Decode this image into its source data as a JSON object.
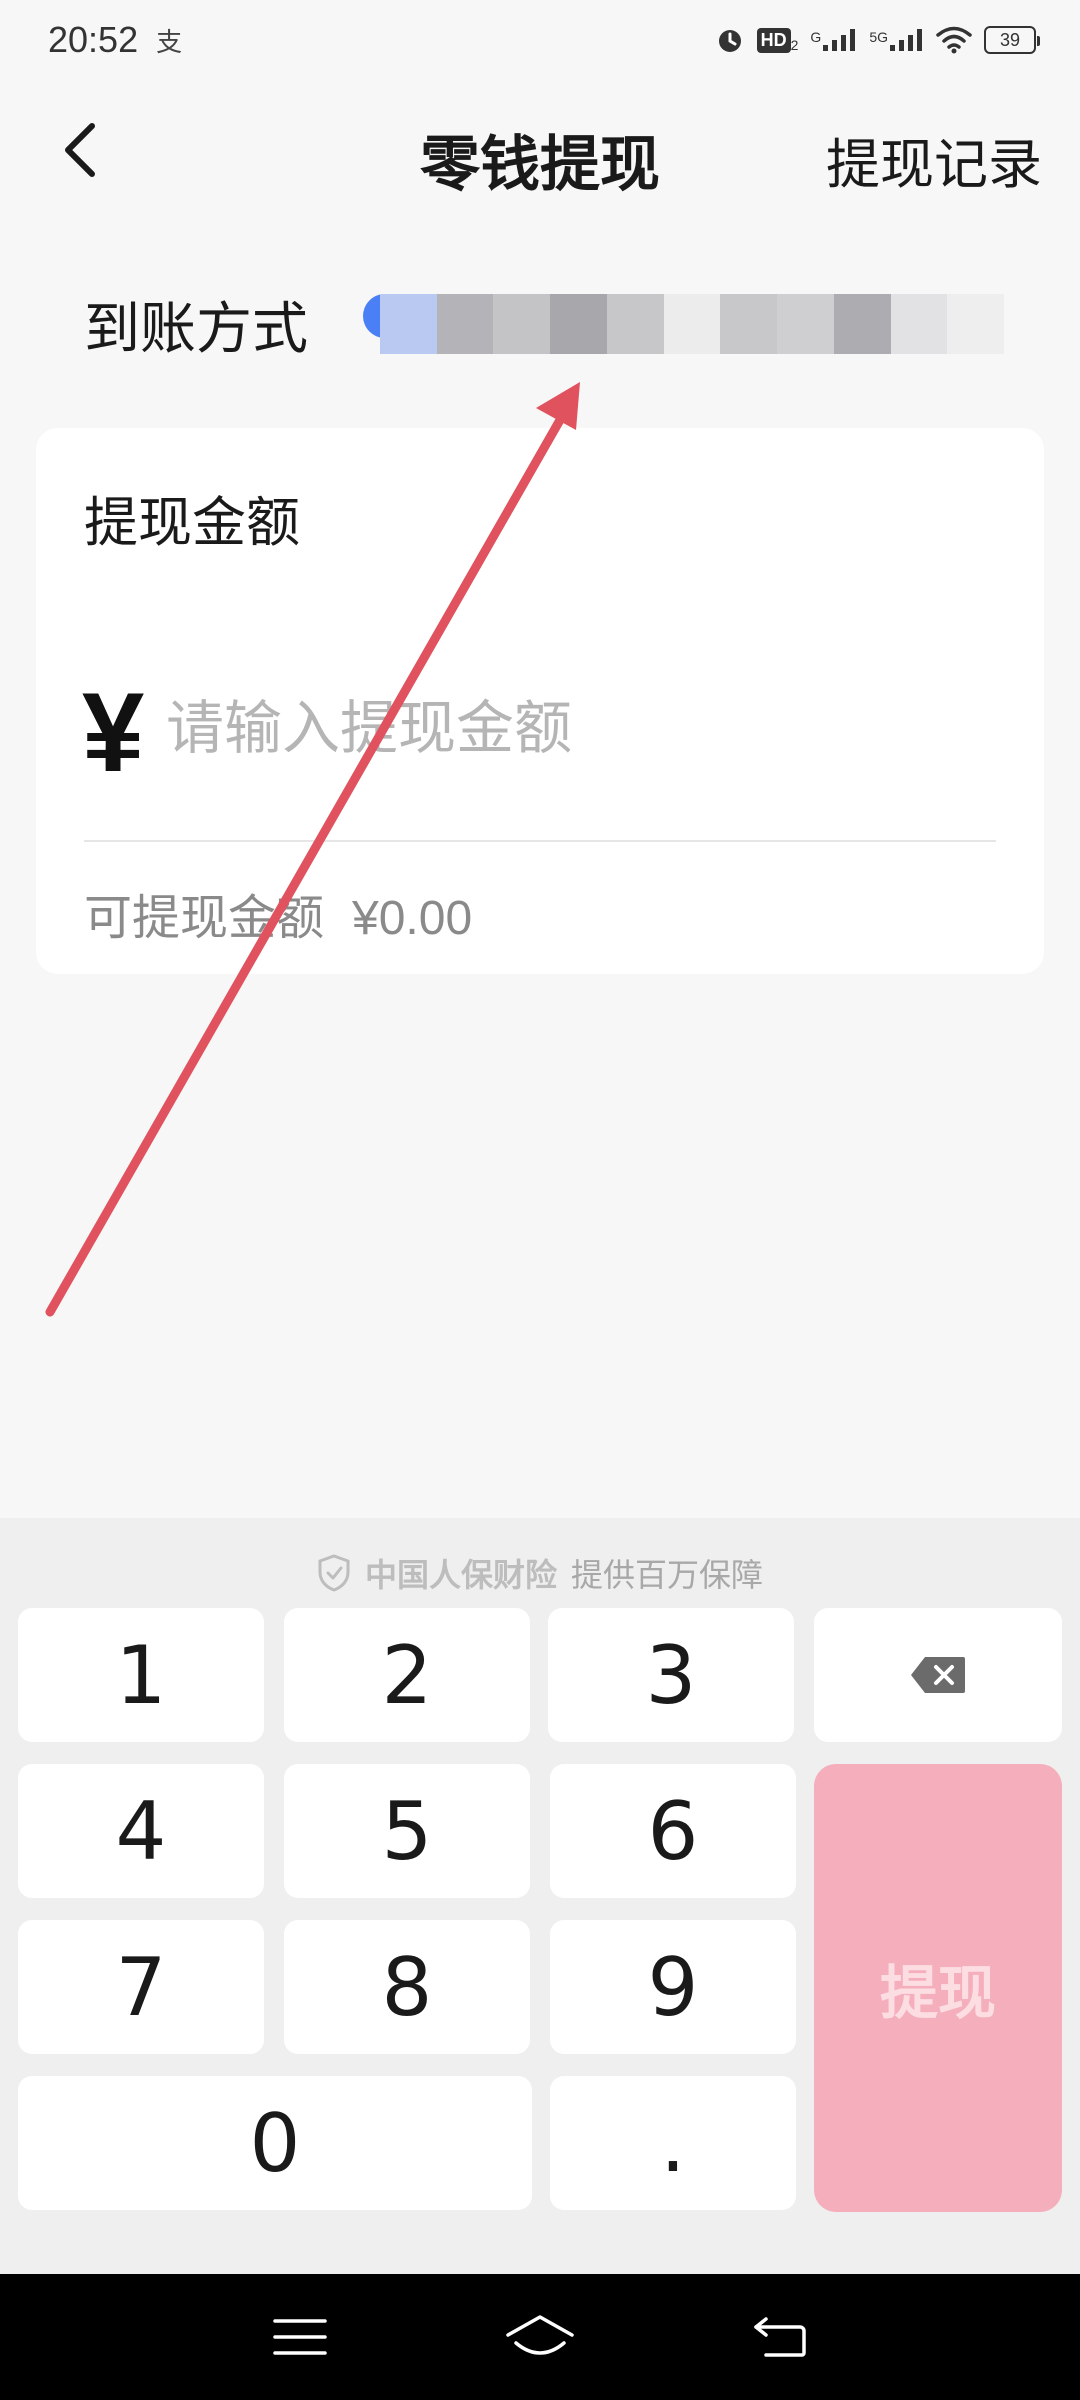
{
  "status_bar": {
    "time": "20:52",
    "app_indicator": "支",
    "hd_label": "HD",
    "hd_sub": "2",
    "signal1_label": "G",
    "signal2_label": "5G",
    "battery_level": "39"
  },
  "nav": {
    "title": "零钱提现",
    "history_link": "提现记录"
  },
  "method": {
    "label": "到账方式",
    "account_blurred": true,
    "icon_color": "#4a7ff5"
  },
  "card": {
    "title": "提现金额",
    "currency": "¥",
    "input_placeholder": "请输入提现金额",
    "input_value": "",
    "available_label": "可提现金额",
    "available_value": "¥0.00"
  },
  "keyboard": {
    "insurance_brand": "中国人保财险",
    "insurance_text": "提供百万保障",
    "keys": {
      "k1": "1",
      "k2": "2",
      "k3": "3",
      "k4": "4",
      "k5": "5",
      "k6": "6",
      "k7": "7",
      "k8": "8",
      "k9": "9",
      "k0": "0",
      "kdot": "."
    },
    "backspace_icon": "backspace-icon",
    "submit_label": "提现",
    "submit_color": "#f5aebb"
  },
  "annotation": {
    "arrow_color": "#e0525e"
  },
  "system_nav": {
    "menu_icon": "menu-icon",
    "home_icon": "home-icon",
    "back_icon": "return-icon"
  }
}
